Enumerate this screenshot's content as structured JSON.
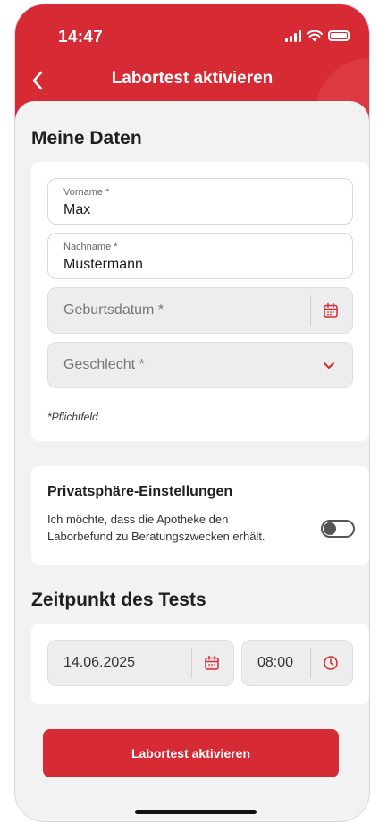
{
  "status_bar": {
    "time": "14:47"
  },
  "header": {
    "title": "Labortest aktivieren"
  },
  "personal": {
    "section_title": "Meine Daten",
    "first_name": {
      "label": "Vorname *",
      "value": "Max"
    },
    "last_name": {
      "label": "Nachname *",
      "value": "Mustermann"
    },
    "birthdate": {
      "placeholder": "Geburtsdatum *"
    },
    "gender": {
      "placeholder": "Geschlecht *"
    },
    "required_hint": "*Pflichtfeld"
  },
  "privacy": {
    "title": "Privatsphäre-Einstellungen",
    "text": "Ich möchte, dass die Apotheke den Laborbefund zu Beratungszwecken erhält.",
    "toggle_on": false
  },
  "test_time": {
    "section_title": "Zeitpunkt des Tests",
    "date": "14.06.2025",
    "time": "08:00"
  },
  "cta_label": "Labortest aktivieren",
  "colors": {
    "brand_red": "#d62b34",
    "accent_red": "#e0434b"
  }
}
